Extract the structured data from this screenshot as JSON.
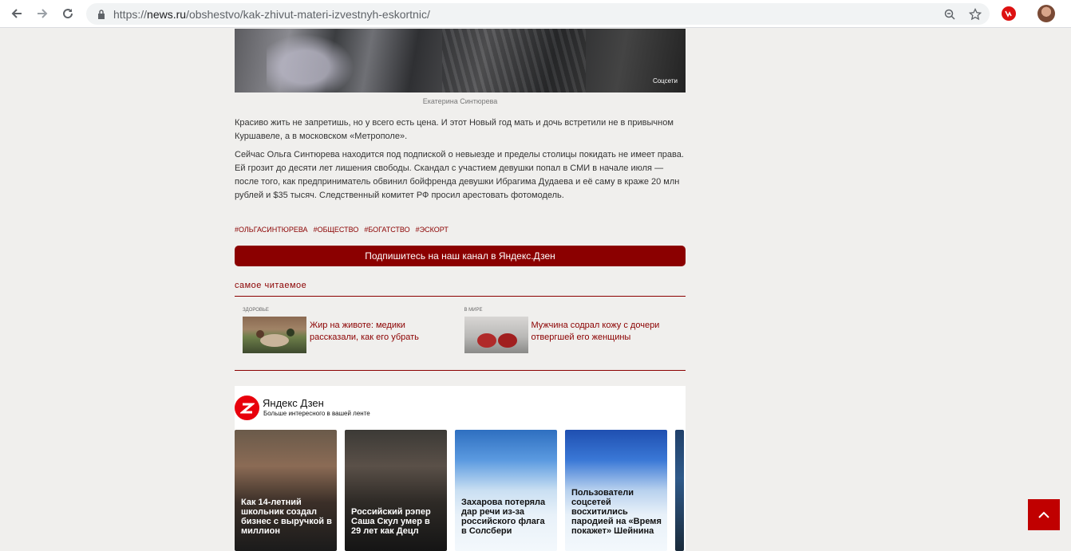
{
  "browser": {
    "url_scheme": "https://",
    "url_host": "news.ru",
    "url_path": "/obshestvo/kak-zhivut-materi-izvestnyh-eskortnic/"
  },
  "article": {
    "photo_credit": "Соцсети",
    "photo_caption": "Екатерина Синтюрева",
    "paragraphs": [
      "Красиво жить не запретишь, но у всего есть цена. И этот Новый год мать и дочь встретили не в привычном Куршавеле, а в московском «Метрополе».",
      "Сейчас Ольга Синтюрева находится под подпиской о невыезде и пределы столицы покидать не имеет права. Ей грозит до десяти лет лишения свободы. Скандал с участием девушки попал в СМИ в начале июля — после того, как предприниматель обвинил бойфренда девушки Ибрагима Дудаева и её саму в краже 20 млн рублей и $35 тысяч. Следственный комитет РФ просил арестовать фотомодель."
    ],
    "tags": [
      "#ОЛЬГАСИНТЮРЕВА",
      "#ОБЩЕСТВО",
      "#БОГАТСТВО",
      "#ЭСКОРТ"
    ],
    "subscribe_label": "Подпишитесь на наш канал в Яндекс.Дзен"
  },
  "most_read": {
    "title": "самое читаемое",
    "items": [
      {
        "category": "ЗДОРОВЬЕ",
        "text": "Жир на животе: медики рассказали, как его убрать"
      },
      {
        "category": "В МИРЕ",
        "text": "Мужчина содрал кожу с дочери отвергшей его женщины"
      }
    ]
  },
  "zen": {
    "title": "Яндекс Дзен",
    "subtitle": "Больше интересного в вашей ленте",
    "cards": [
      {
        "title": "Как 14-летний школьник создал бизнес с выручкой в миллион"
      },
      {
        "title": "Российский рэпер Саша Скул умер в 29 лет как Децл"
      },
      {
        "title": "Захарова потеряла дар речи из-за российского флага в Солсбери"
      },
      {
        "title": "Пользователи соцсетей восхитились пародией на «Время покажет» Шейнина"
      }
    ]
  },
  "colors": {
    "accent": "#8b0000",
    "scroll_top": "#c00000",
    "zen_red": "#e8000c"
  },
  "icons": [
    "back-arrow-icon",
    "forward-arrow-icon",
    "reload-icon",
    "lock-icon",
    "zoom-icon",
    "star-icon",
    "extension-icon",
    "profile-avatar",
    "zen-logo-icon",
    "chevron-up-icon"
  ]
}
